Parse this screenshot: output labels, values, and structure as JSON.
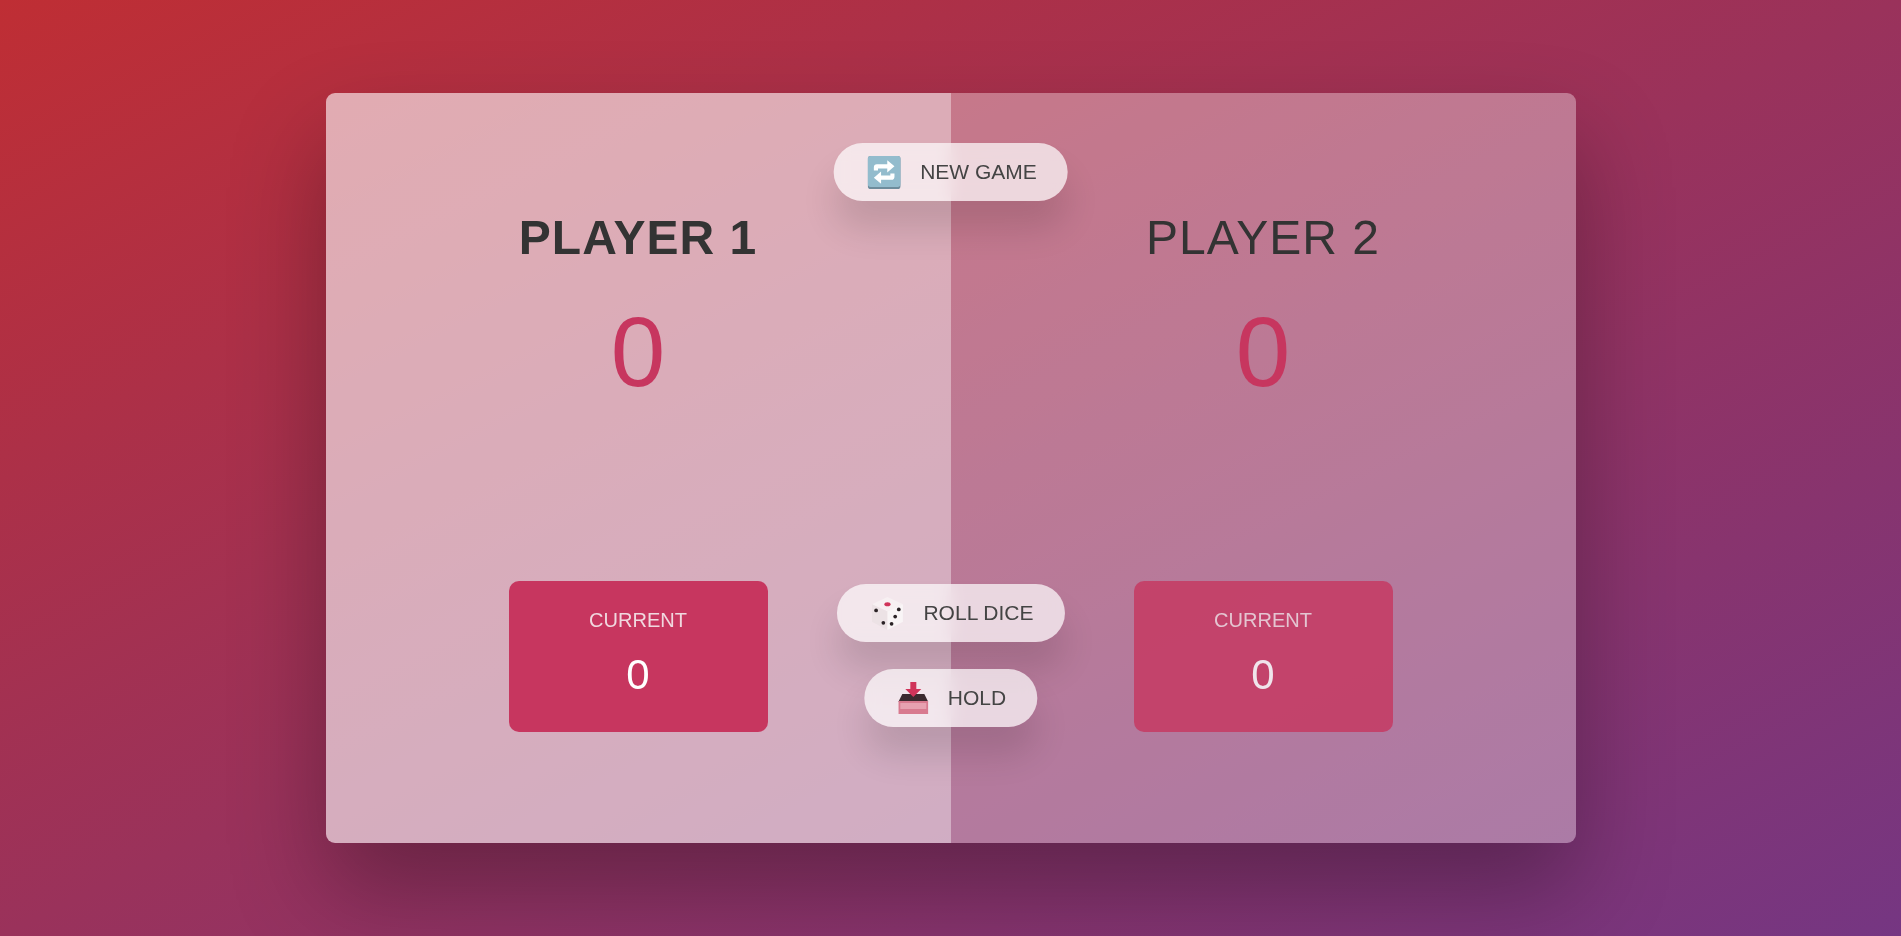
{
  "players": [
    {
      "name": "PLAYER 1",
      "score": "0",
      "current_label": "CURRENT",
      "current": "0",
      "active": true
    },
    {
      "name": "PLAYER 2",
      "score": "0",
      "current_label": "CURRENT",
      "current": "0",
      "active": false
    }
  ],
  "controls": {
    "new_game": {
      "label": "NEW GAME"
    },
    "roll_dice": {
      "label": "ROLL DICE"
    },
    "hold": {
      "label": "HOLD"
    }
  }
}
